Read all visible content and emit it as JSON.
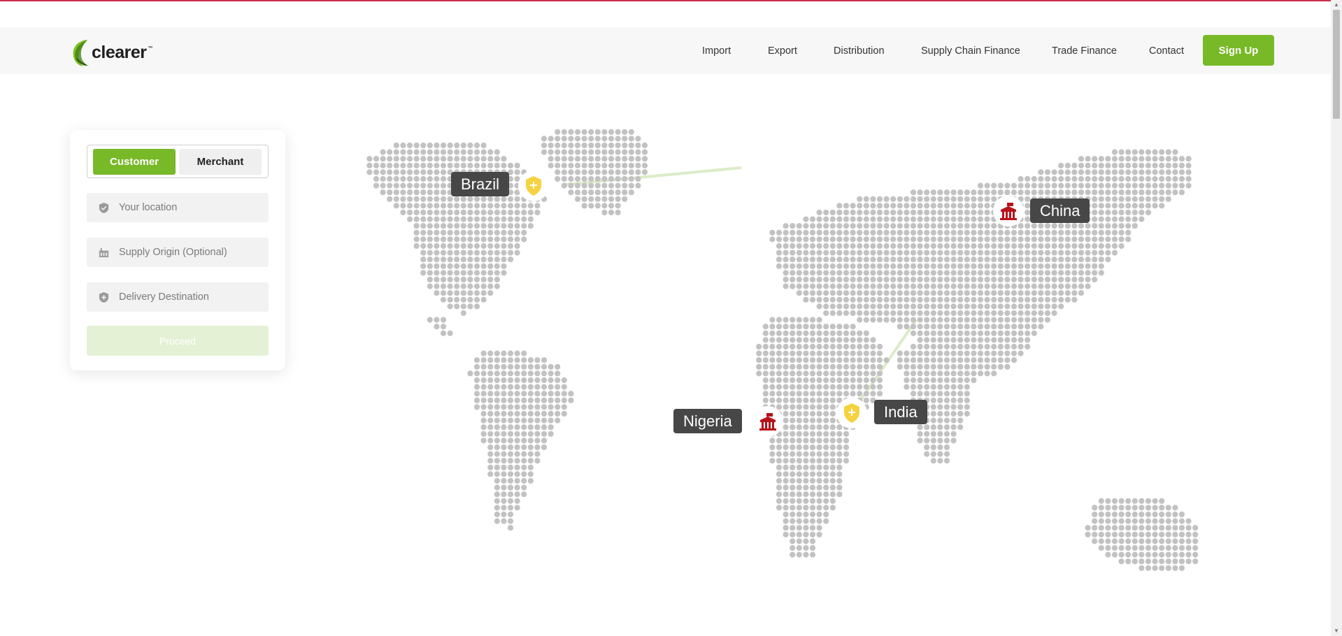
{
  "brand": {
    "name": "clearer",
    "tm": "™"
  },
  "nav": {
    "items": [
      "Import",
      "Export",
      "Distribution",
      "Supply Chain Finance",
      "Trade Finance",
      "Contact"
    ],
    "signup_label": "Sign Up"
  },
  "panel": {
    "tabs": {
      "customer": "Customer",
      "merchant": "Merchant"
    },
    "fields": {
      "location_placeholder": "Your location",
      "origin_placeholder": "Supply Origin (Optional)",
      "destination_placeholder": "Delivery Destination"
    },
    "proceed_label": "Proceed"
  },
  "map": {
    "labels": {
      "brazil": "Brazil",
      "china": "China",
      "nigeria": "Nigeria",
      "india": "India"
    },
    "colors": {
      "dot": "#c2c2c2",
      "route": "#dbecc8",
      "pin": "#f5d240",
      "building": "#b8121b"
    }
  }
}
